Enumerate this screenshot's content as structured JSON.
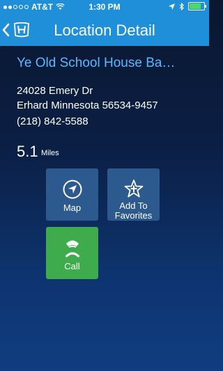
{
  "status_bar": {
    "carrier": "AT&T",
    "time": "1:30 PM"
  },
  "nav": {
    "title": "Location Detail"
  },
  "location": {
    "name": "Ye Old School House Ba…",
    "street": "24028 Emery Dr",
    "city_line": "Erhard Minnesota 56534-9457",
    "phone": "(218) 842-5588",
    "distance_value": "5.1",
    "distance_unit": "Miles"
  },
  "actions": {
    "map_label": "Map",
    "favorite_label_line1": "Add To",
    "favorite_label_line2": "Favorites",
    "call_label": "Call"
  },
  "colors": {
    "header": "#1e8fd8",
    "accent_text": "#5bb8ff",
    "tile_blue": "#2d5a8e",
    "tile_green": "#3eab4c"
  }
}
